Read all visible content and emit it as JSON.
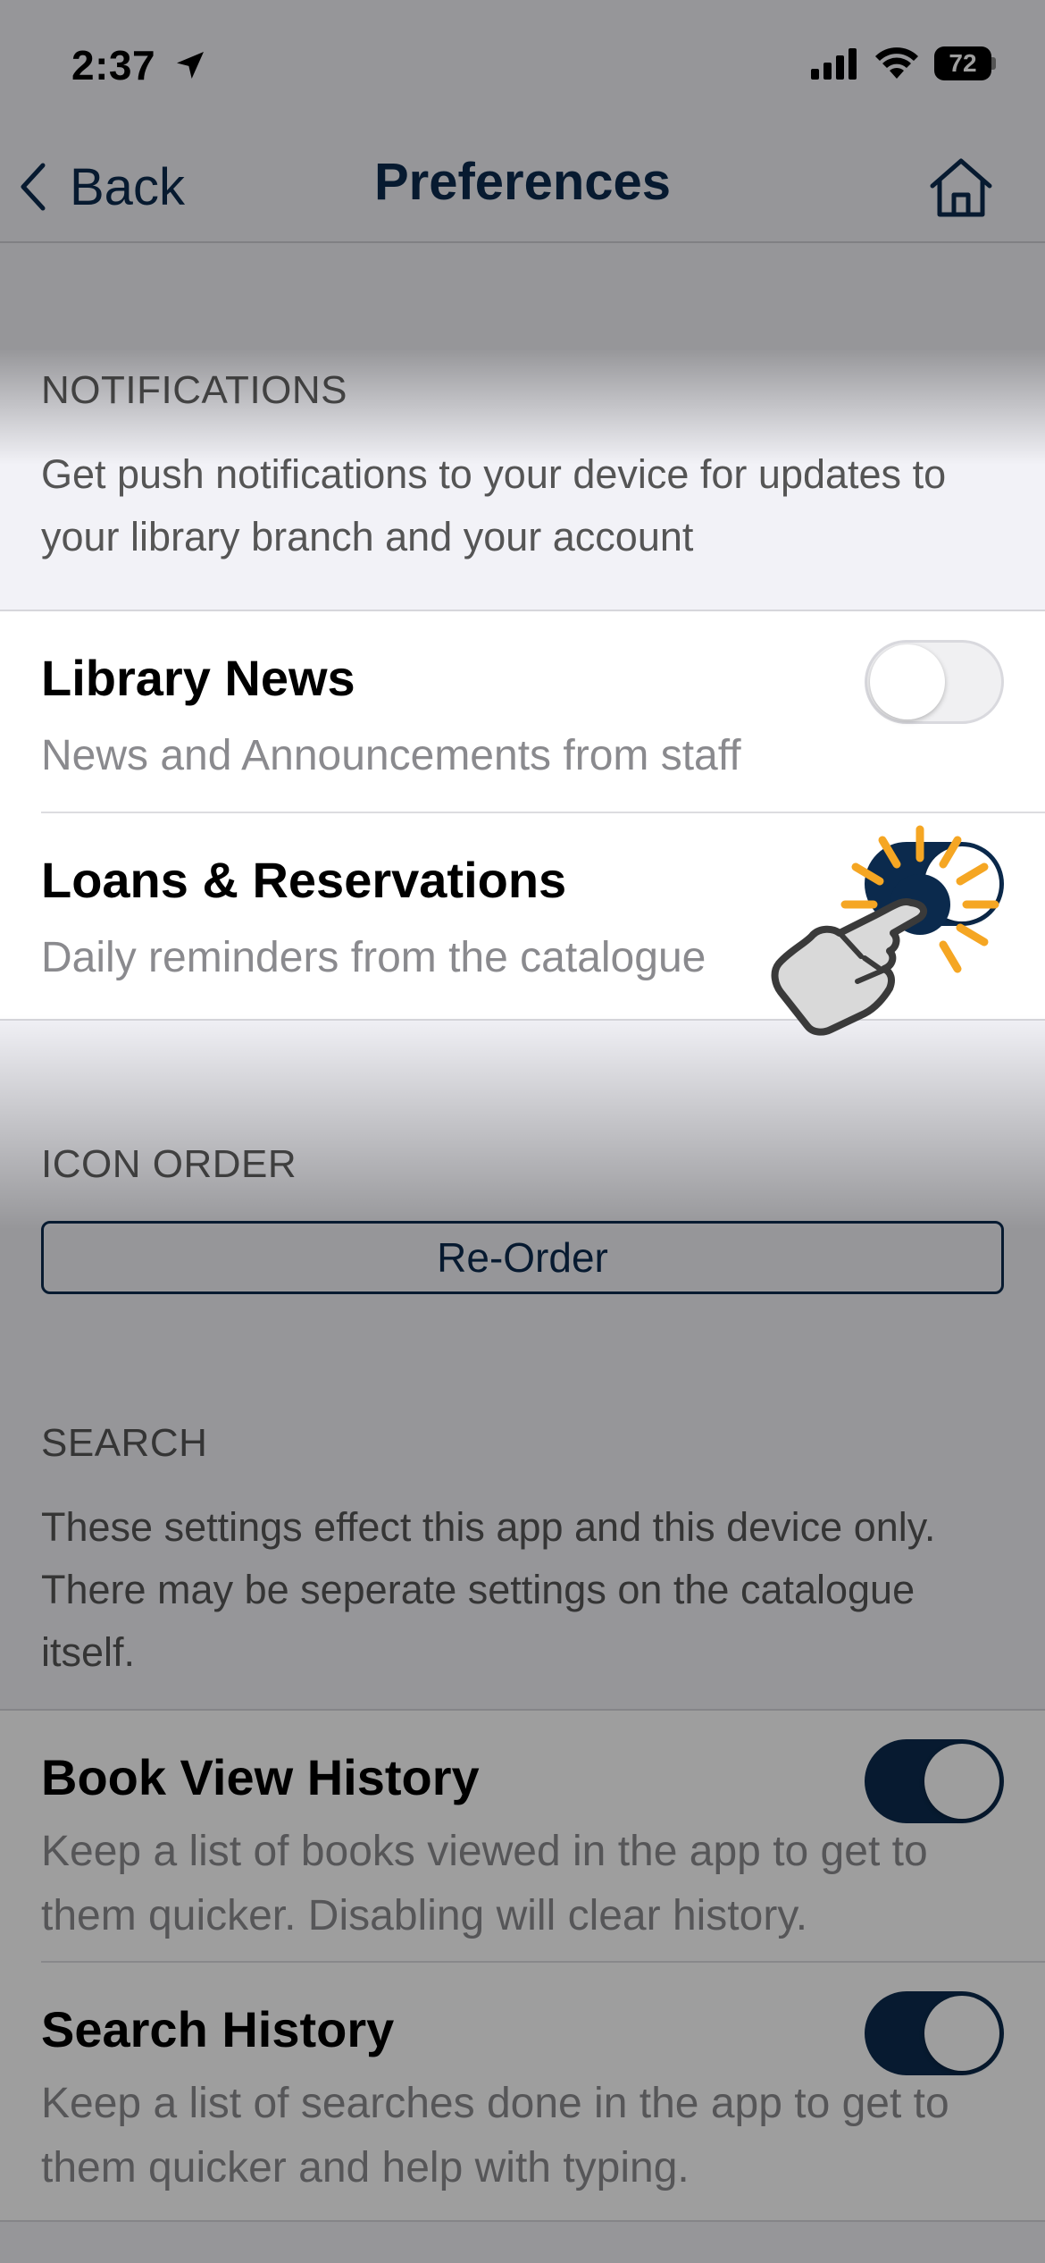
{
  "status_bar": {
    "time": "2:37",
    "battery": "72"
  },
  "nav": {
    "back_label": "Back",
    "title": "Preferences"
  },
  "notifications": {
    "header": "NOTIFICATIONS",
    "description": "Get push notifications to your device for updates to your library branch and your account",
    "items": [
      {
        "title": "Library News",
        "subtitle": "News and Announcements from staff",
        "enabled": false
      },
      {
        "title": "Loans & Reservations",
        "subtitle": "Daily reminders from the catalogue",
        "enabled": true
      }
    ]
  },
  "icon_order": {
    "header": "ICON ORDER",
    "button_label": "Re-Order"
  },
  "search": {
    "header": "SEARCH",
    "description": "These settings effect this app and this device only. There may be seperate settings on the catalogue itself.",
    "items": [
      {
        "title": "Book View History",
        "subtitle": "Keep a list of books viewed in the app to get to them quicker. Disabling will clear history.",
        "enabled": true
      },
      {
        "title": "Search History",
        "subtitle": "Keep a list of searches done in the app to get to them quicker and help with typing.",
        "enabled": true
      }
    ]
  },
  "colors": {
    "accent": "#0b2a4d",
    "tap_highlight": "#f5a623"
  }
}
